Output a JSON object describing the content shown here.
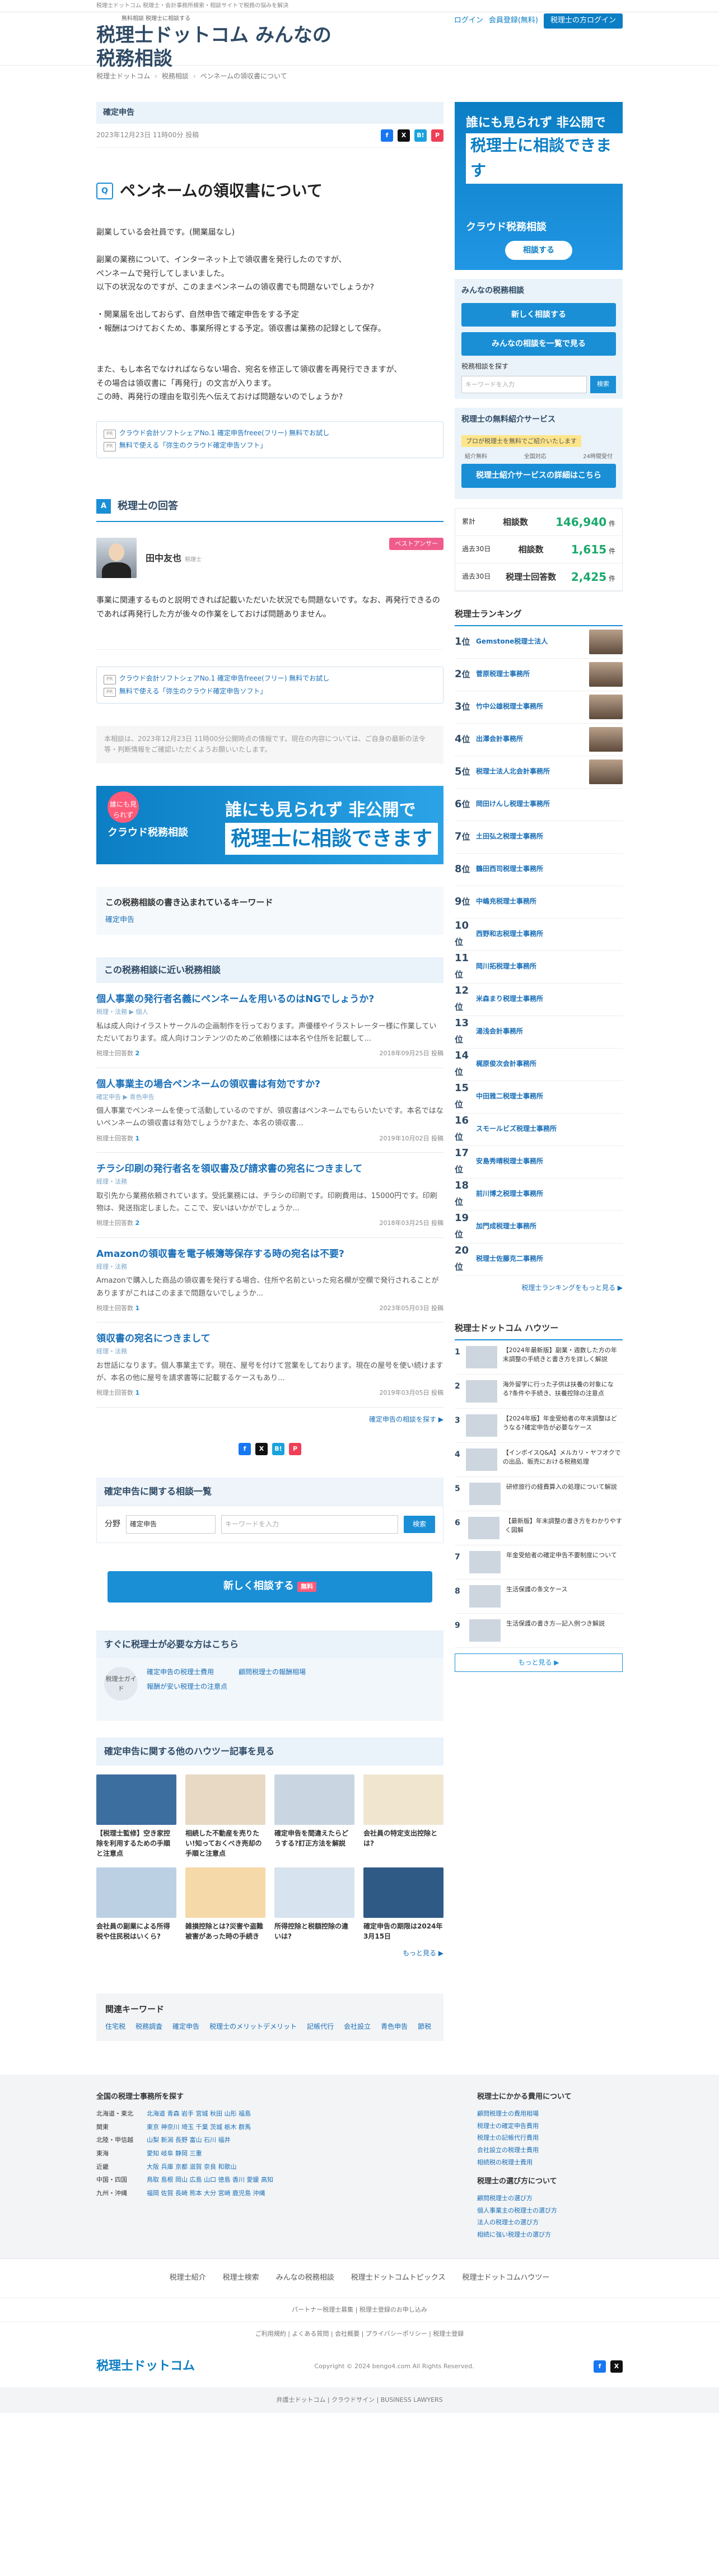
{
  "top": {
    "notice": "税理士ドットコム 税理士・会計事務所検索・相談サイトで税務の悩みを解決"
  },
  "header": {
    "logo_small": "無料相談 税理士に相談する",
    "logo_main": "税理士ドットコム",
    "logo_sub": "みんなの税務相談",
    "login": "ログイン",
    "signup": "会員登録(無料)",
    "tax_login": "税理士の方ログイン"
  },
  "breadcrumb": [
    "税理士ドットコム",
    "税務相談",
    "ベンネームの領収書について"
  ],
  "question": {
    "category": "確定申告",
    "date": "2023年12月23日 11時00分 投稿",
    "badge": "Q",
    "title": "ペンネームの領収書について",
    "body": "副業している会社員です。(開業届なし)\n\n副業の業務について、インターネット上で領収書を発行したのですが、\nペンネームで発行してしまいました。\n以下の状況なのですが、このままペンネームの領収書でも問題ないでしょうか?\n\n・開業届を出しておらず、自然申告で確定申告をする予定\n・報酬はつけておくため、事業所得とする予定。領収書は業務の記録として保存。\n\n\nまた、もし本名でなければならない場合、宛名を修正して領収書を再発行できますが、\nその場合は領収書に「再発行」の文言が入ります。\nこの時、再発行の理由を取引先へ伝えておけば問題ないのでしょうか?"
  },
  "promo": {
    "pr": "PR",
    "l1": "クラウド会計ソフトシェアNo.1 確定申告freee(フリー) 無料でお試し",
    "l2": "無料で使える「弥生のクラウド確定申告ソフト」"
  },
  "answer": {
    "badge": "A",
    "heading": "税理士の回答",
    "name": "田中友也",
    "role": "税理士",
    "best": "ベストアンサー",
    "body": "事業に関連するものと説明できれば記載いただいた状況でも問題ないです。なお、再発行できるのであれば再発行した方が後々の作業をしておけば問題ありません。"
  },
  "notice": "本相談は、2023年12月23日 11時00分公開時点の情報です。現在の内容については、ご自身の最新の法令等・判断情報をご確認いただくようお願いいたします。",
  "banner": {
    "circle": "誰にも見られず",
    "l1": "誰にも見られず 非公開で",
    "l2": "税理士に相談できます",
    "logo": "クラウド税務相談"
  },
  "keywords": {
    "title": "この税務相談の書き込まれているキーワード",
    "items": [
      "確定申告"
    ]
  },
  "related": {
    "title": "この税務相談に近い税務相談",
    "items": [
      {
        "title": "個人事業の発行者名義にペンネームを用いるのはNGでしょうか?",
        "tag": "税理・法務 ▶ 個人",
        "body": "私は成人向けイラストサークルの企画制作を行っております。声優様やイラストレーター様に作業していただいております。成人向けコンテンツのためご依頼様には本名や住所を記載して...",
        "count": "2",
        "date": "2018年09月25日 投稿"
      },
      {
        "title": "個人事業主の場合ペンネームの領収書は有効ですか?",
        "tag": "確定申告 ▶ 青色申告",
        "body": "個人事業でペンネームを使って活動しているのですが、領収書はペンネームでもらいたいです。本名ではないペンネームの領収書は有効でしょうか?また、本名の領収書...",
        "count": "1",
        "date": "2019年10月02日 投稿"
      },
      {
        "title": "チラシ印刷の発行者名を領収書及び請求書の宛名につきまして",
        "tag": "経理・法務",
        "body": "取引先から業務依頼されています。受託業務には、チラシの印刷です。印刷費用は、15000円です。印刷物は、発送指定しました。ここで、安いはいかがでしょうか...",
        "count": "2",
        "date": "2018年03月25日 投稿"
      },
      {
        "title": "Amazonの領収書を電子帳簿等保存する時の宛名は不要?",
        "tag": "経理・法務",
        "body": "Amazonで購入した商品の領収書を発行する場合、住所や名前といった宛名欄が空欄で発行されることがありますがこれはこのままで問題ないでしょうか...",
        "count": "1",
        "date": "2023年05月03日 投稿"
      },
      {
        "title": "領収書の宛名につきまして",
        "tag": "経理・法務",
        "body": "お世話になります。個人事業主です。現在、屋号を付けて営業をしております。現在の屋号を使い続けますが、本名の他に屋号を請求書等に記載するケースもあり...",
        "count": "1",
        "date": "2019年03月05日 投稿"
      }
    ],
    "more": "確定申告の相談を探す ▶",
    "count_label": "税理士回答数"
  },
  "search": {
    "title": "確定申告に関する相談一覧",
    "label": "分野",
    "select": "確定申告",
    "placeholder": "キーワードを入力",
    "button": "検索"
  },
  "newq": {
    "label": "新しく相談する",
    "badge": "無料"
  },
  "need": {
    "title": "すぐに税理士が必要な方はこちら",
    "guide": "税理士ガイド",
    "items": [
      "確定申告の税理士費用",
      "顧問税理士の報酬相場",
      "報酬が安い税理士の注意点"
    ]
  },
  "howto": {
    "title": "確定申告に関する他のハウツー記事を見る",
    "cards": [
      "【税理士監修】空き家控除を利用するための手順と注意点",
      "相続した不動産を売りたい!知っておくべき売却の手順と注意点",
      "確定申告を間違えたらどうする?訂正方法を解説",
      "会社員の特定支出控除とは?",
      "会社員の副業による所得税や住民税はいくら?",
      "雑損控除とは?災害や盗難被害があった時の手続き",
      "所得控除と税額控除の違いは?",
      "確定申告の期限は2024年3月15日"
    ],
    "more": "もっと見る ▶"
  },
  "bottom_kw": {
    "title": "関連キーワード",
    "items": [
      "住宅税",
      "税務調査",
      "確定申告",
      "税理士のメリットデメリット",
      "記帳代行",
      "会社設立",
      "青色申告",
      "節税"
    ]
  },
  "side": {
    "ad": {
      "t1": "誰にも見られず 非公開で",
      "t2": "税理士に相談できます",
      "logo": "クラウド税務相談",
      "btn": "相談する"
    },
    "minna": {
      "title": "みんなの税務相談",
      "new": "新しく相談する",
      "list": "みんなの相談を一覧で見る",
      "search_label": "税務相談を探す",
      "placeholder": "キーワードを入力",
      "search_btn": "検索"
    },
    "intro": {
      "title": "税理士の無料紹介サービス",
      "tag": "プロが税理士を無料でご紹介いたします",
      "f1": "紹介無料",
      "f2": "全国対応",
      "f3": "24時間受付",
      "btn": "税理士紹介サービスの詳細はこちら"
    },
    "stats": [
      {
        "tag": "累計",
        "label": "相談数",
        "value": "146,940",
        "unit": "件"
      },
      {
        "tag": "過去30日",
        "label": "相談数",
        "value": "1,615",
        "unit": "件"
      },
      {
        "tag": "過去30日",
        "label": "税理士回答数",
        "value": "2,425",
        "unit": "件"
      }
    ],
    "ranking": {
      "title": "税理士ランキング",
      "items": [
        "Gemstone税理士法人",
        "菅原税理士事務所",
        "竹中公雄税理士事務所",
        "出澤会計事務所",
        "税理士法人北会計事務所",
        "岡田けんし税理士事務所",
        "土田弘之税理士事務所",
        "鶴田西司税理士事務所",
        "中嶋充税理士事務所",
        "西野和志税理士事務所",
        "岡川拓税理士事務所",
        "米森まり税理士事務所",
        "湯浅会計事務所",
        "梶原俊次会計事務所",
        "中田雅二税理士事務所",
        "スモールビズ税理士事務所",
        "安島秀晴税理士事務所",
        "前川博之税理士事務所",
        "加門成税理士事務所",
        "税理士佐藤克二事務所"
      ],
      "more": "税理士ランキングをもっと見る ▶",
      "unit": "位"
    },
    "howto": {
      "title": "税理士ドットコム ハウツー",
      "items": [
        "【2024年最新版】副業・週数した方の年末調整の手続きと書き方を詳しく解説",
        "海外留学に行った子供は扶養の対象になる?条件や手続き、扶養控除の注意点",
        "【2024年版】年金受給者の年末調整はどうなる?確定申告が必要なケース",
        "【インボイスQ&A】メルカリ・ヤフオクでの出品、販売における税務処理",
        "研修旅行の経費算入の処理について解説",
        "【最新版】年末調整の書き方をわかりやすく図解",
        "年金受給者の確定申告不要制度について",
        "生活保護の条文ケース",
        "生活保護の書き方—記入例つき解説"
      ],
      "more": "もっと見る ▶"
    }
  },
  "footer": {
    "pref_title": "全国の税理士事務所を探す",
    "prefs": [
      [
        "北海道・東北",
        "北海道 青森 岩手 宮城 秋田 山形 福島"
      ],
      [
        "関東",
        "東京 神奈川 埼玉 千葉 茨城 栃木 群馬"
      ],
      [
        "北陸・甲信越",
        "山梨 新潟 長野 富山 石川 福井"
      ],
      [
        "東海",
        "愛知 岐阜 静岡 三重"
      ],
      [
        "近畿",
        "大阪 兵庫 京都 滋賀 奈良 和歌山"
      ],
      [
        "中国・四国",
        "鳥取 島根 岡山 広島 山口 徳島 香川 愛媛 高知"
      ],
      [
        "九州・沖縄",
        "福岡 佐賀 長崎 熊本 大分 宮崎 鹿児島 沖縄"
      ]
    ],
    "sub_title": "税理士にかかる費用について",
    "subs": [
      "顧問税理士の費用相場",
      "税理士の確定申告費用",
      "税理士の記帳代行費用",
      "会社設立の税理士費用",
      "相続税の税理士費用"
    ],
    "sub2_title": "税理士の選び方について",
    "subs2": [
      "顧問税理士の選び方",
      "個人事業主の税理士の選び方",
      "法人の税理士の選び方",
      "相続に強い税理士の選び方"
    ],
    "links": [
      "税理士紹介",
      "税理士検索",
      "みんなの税務相談",
      "税理士ドットコムトピックス",
      "税理士ドットコムハウツー"
    ],
    "partner": "パートナー税理士募集 | 税理士登録のお申し込み",
    "small": "ご利用規約 | よくある質問 | 会社概要 | プライバシーポリシー | 税理士登録",
    "logo": "税理士ドットコム",
    "copy": "Copyright © 2024 bengo4.com All Rights Reserved.",
    "bottom": "弁護士ドットコム | クラウドサイン | BUSINESS LAWYERS"
  }
}
